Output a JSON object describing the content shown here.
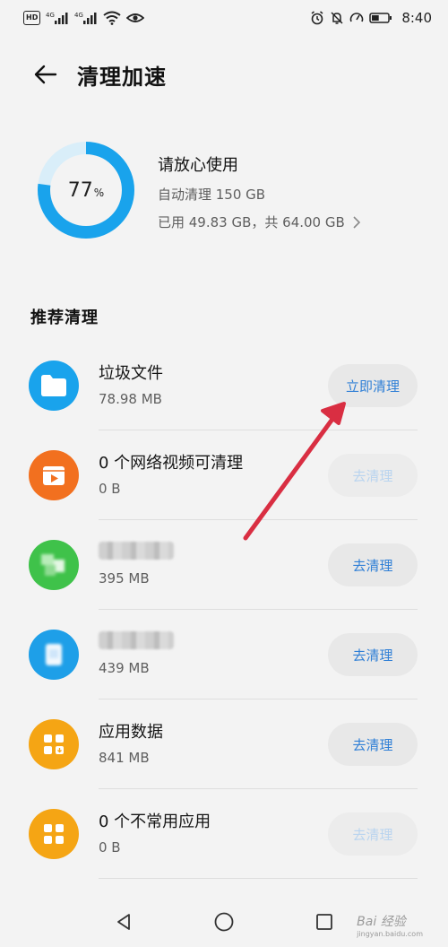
{
  "status_bar": {
    "time": "8:40",
    "hd": "HD",
    "net_4g_1": "4G",
    "net_4g_2": "4G",
    "battery_level": 0.45
  },
  "header": {
    "title": "清理加速"
  },
  "summary": {
    "percent_value": 77,
    "percent_number": "77",
    "percent_unit": "%",
    "title": "请放心使用",
    "auto_clean": "自动清理 150 GB",
    "storage": "已用 49.83 GB，共 64.00 GB"
  },
  "section": {
    "title": "推荐清理"
  },
  "items": [
    {
      "title": "垃圾文件",
      "size": "78.98 MB",
      "button": "立即清理",
      "icon": "folder-icon",
      "color": "#19a3ec",
      "enabled": true
    },
    {
      "title": "0 个网络视频可清理",
      "size": "0 B",
      "button": "去清理",
      "icon": "video-icon",
      "color": "#f2701f",
      "enabled": false
    },
    {
      "title": "",
      "size": "395 MB",
      "button": "去清理",
      "icon": "app-icon",
      "color": "#3fc24a",
      "enabled": true
    },
    {
      "title": "",
      "size": "439 MB",
      "button": "去清理",
      "icon": "app-icon",
      "color": "#1e9fe8",
      "enabled": true
    },
    {
      "title": "应用数据",
      "size": "841 MB",
      "button": "去清理",
      "icon": "grid-icon",
      "color": "#f5a514",
      "enabled": true
    },
    {
      "title": "0 个不常用应用",
      "size": "0 B",
      "button": "去清理",
      "icon": "grid-icon",
      "color": "#f5a514",
      "enabled": false
    }
  ],
  "colors": {
    "accent": "#2f7fd6",
    "gauge": "#19a3ec",
    "gauge_track": "#d9eef9",
    "arrow": "#d92e42"
  },
  "watermark": {
    "text": "Bai 经验",
    "sub": "jingyan.baidu.com"
  }
}
